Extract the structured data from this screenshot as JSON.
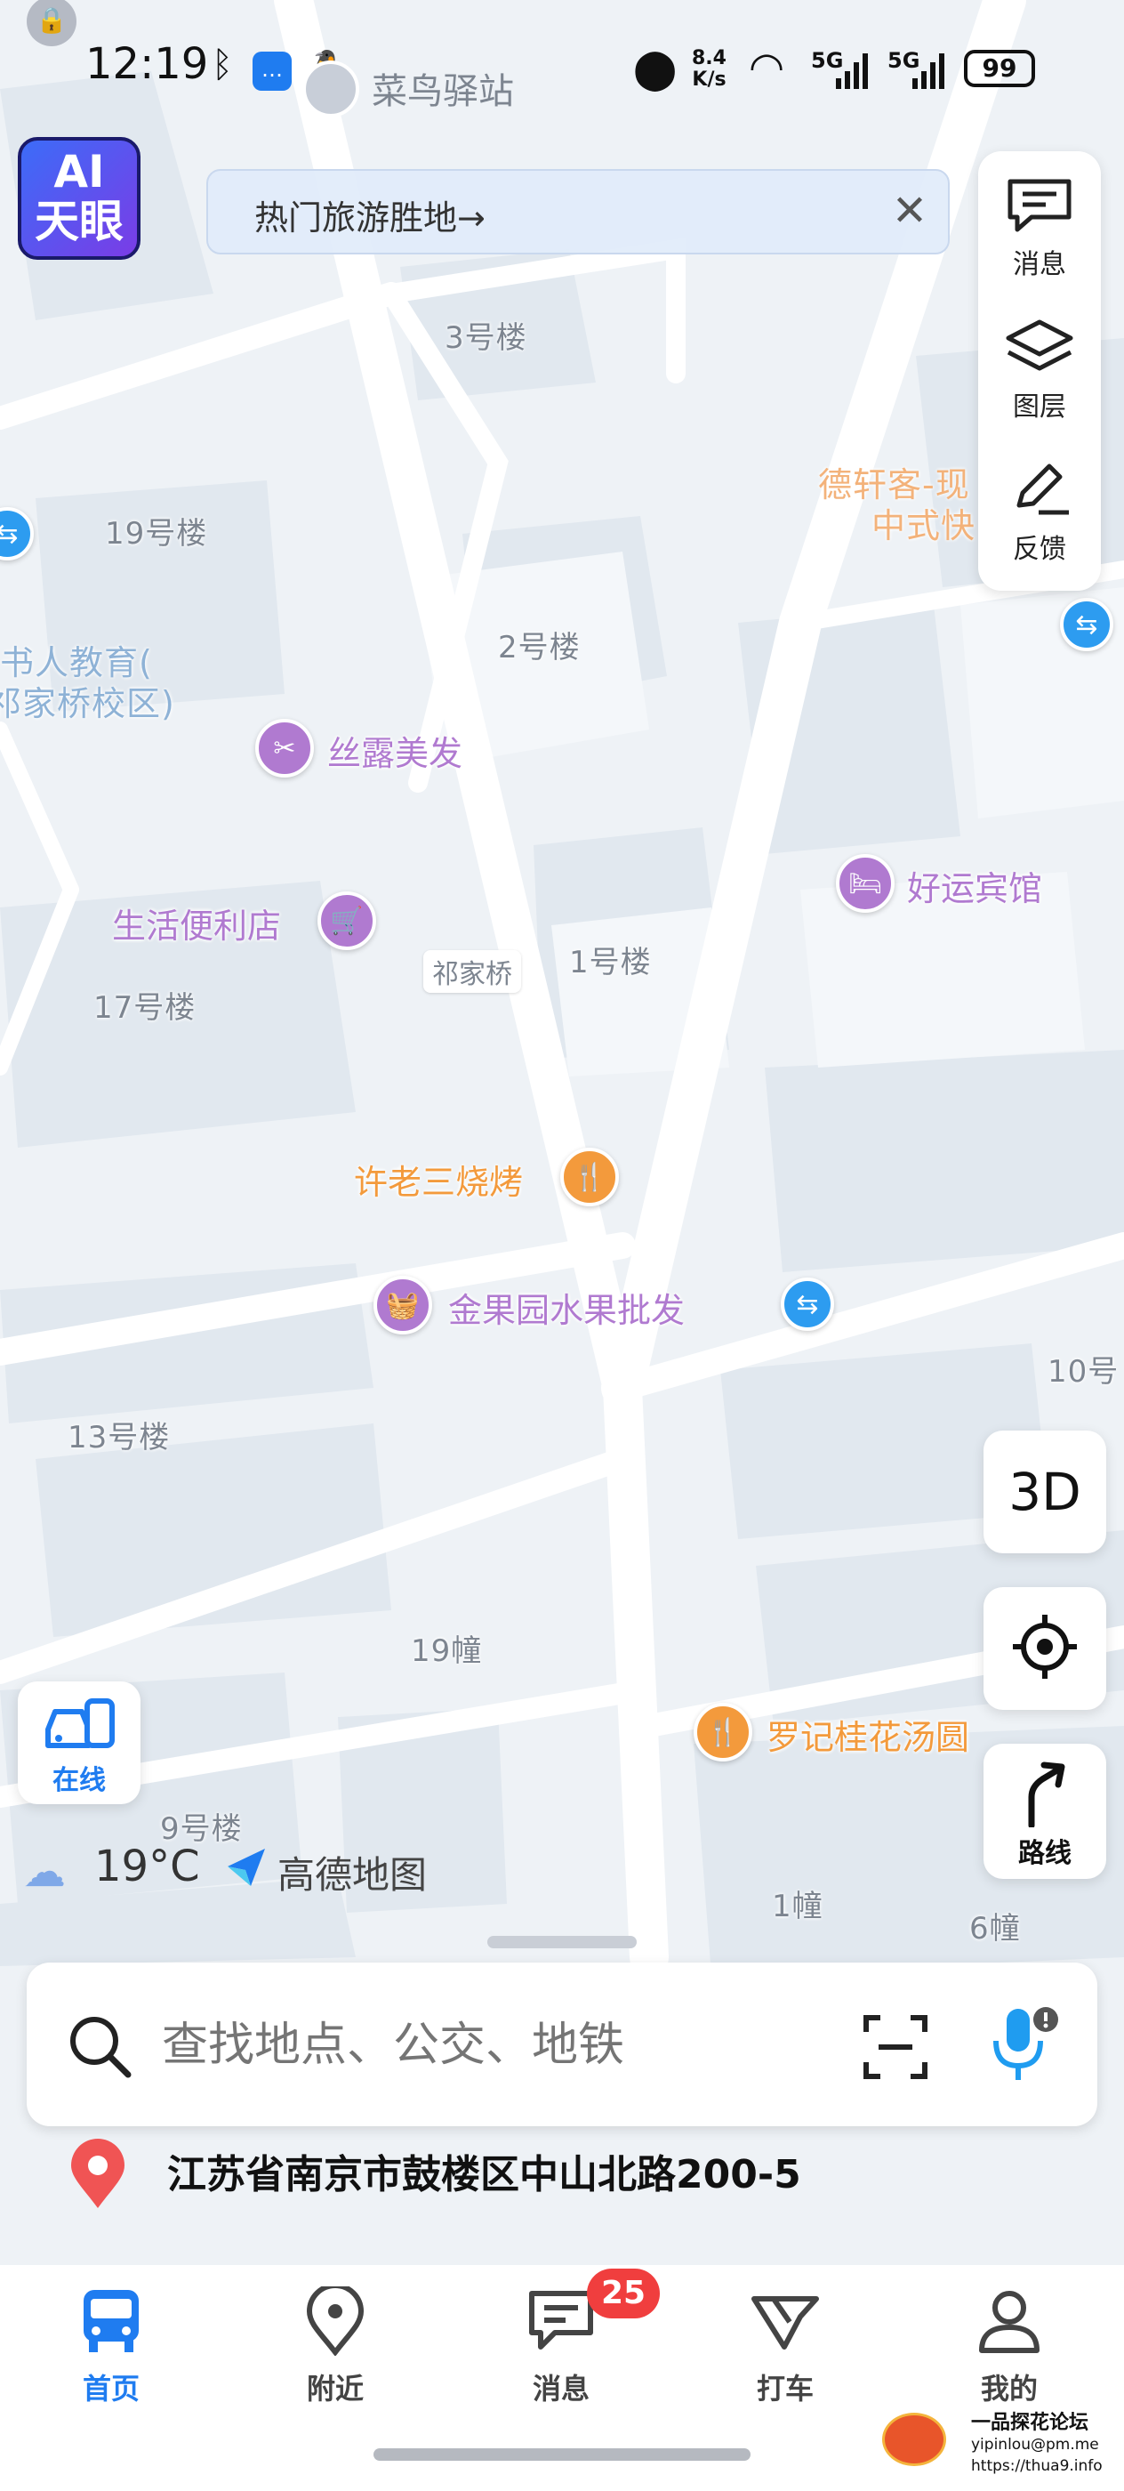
{
  "status_bar": {
    "time": "12:19",
    "network_speed_top": "8.4",
    "network_speed_bottom": "K/s",
    "signal1": "5G",
    "signal2": "5G",
    "battery": "99",
    "notification_app": "菜鸟驿站"
  },
  "ai_button": {
    "line1": "AI",
    "line2": "天眼"
  },
  "promo_banner": {
    "text": "热门旅游胜地→"
  },
  "side_menu": {
    "messages": "消息",
    "layers": "图层",
    "feedback": "反馈"
  },
  "map_labels": {
    "b3": "3号楼",
    "b19": "19号楼",
    "b2": "2号楼",
    "b1": "1号楼",
    "b17": "17号楼",
    "b13": "13号楼",
    "b9": "9号楼",
    "b10": "10号",
    "z19": "19幢",
    "z1": "1幢",
    "z6": "6幢",
    "qijiaqiao": "祁家桥",
    "edu_line1": "书人教育(",
    "edu_line2": "祁家桥校区)",
    "dexuan_line1": "德轩客-现",
    "dexuan_line2": "中式快"
  },
  "pois": {
    "hair": "丝露美发",
    "store": "生活便利店",
    "hotel": "好运宾馆",
    "bbq": "许老三烧烤",
    "fruit": "金果园水果批发",
    "soup": "罗记桂花汤圆"
  },
  "controls": {
    "online_label": "在线",
    "three_d": "3D",
    "route": "路线",
    "weather_temp": "19°C",
    "logo_text": "高德地图"
  },
  "search": {
    "placeholder": "查找地点、公交、地铁",
    "address": "江苏省南京市鼓楼区中山北路200-5"
  },
  "bottom_nav": {
    "home": "首页",
    "nearby": "附近",
    "messages": "消息",
    "messages_badge": "25",
    "taxi": "打车",
    "mine": "我的"
  },
  "watermark": {
    "line1": "一品探花论坛",
    "line2": "yipinlou@pm.me",
    "line3": "https://thua9.info"
  },
  "colors": {
    "accent_blue": "#1f7cf0",
    "poi_purple": "#b07ad0",
    "poi_orange": "#f39a3c",
    "badge_red": "#f03e3e",
    "address_pin": "#f05454"
  }
}
